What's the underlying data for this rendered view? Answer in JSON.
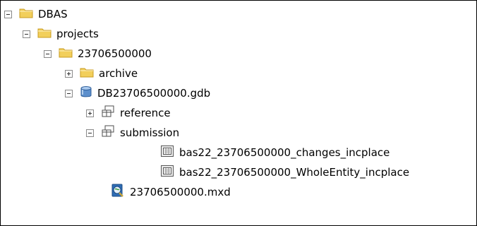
{
  "tree": {
    "nodes": [
      {
        "label": "DBAS",
        "icon": "folder-icon",
        "toggle": "minus"
      },
      {
        "label": "projects",
        "icon": "folder-icon",
        "toggle": "minus"
      },
      {
        "label": "23706500000",
        "icon": "folder-icon",
        "toggle": "minus"
      },
      {
        "label": "archive",
        "icon": "folder-icon",
        "toggle": "plus"
      },
      {
        "label": "DB23706500000.gdb",
        "icon": "geodatabase-icon",
        "toggle": "minus"
      },
      {
        "label": "reference",
        "icon": "feature-dataset-icon",
        "toggle": "plus"
      },
      {
        "label": "submission",
        "icon": "feature-dataset-icon",
        "toggle": "minus"
      },
      {
        "label": "bas22_23706500000_changes_incplace",
        "icon": "feature-class-icon",
        "toggle": "none"
      },
      {
        "label": "bas22_23706500000_WholeEntity_incplace",
        "icon": "feature-class-icon",
        "toggle": "none"
      },
      {
        "label": "23706500000.mxd",
        "icon": "map-document-icon",
        "toggle": "none"
      }
    ]
  },
  "colors": {
    "folder": "#f2cf5b",
    "folder_outline": "#c89b1f",
    "geodatabase": "#4a7fbf",
    "map_document": "#2f6db5"
  }
}
